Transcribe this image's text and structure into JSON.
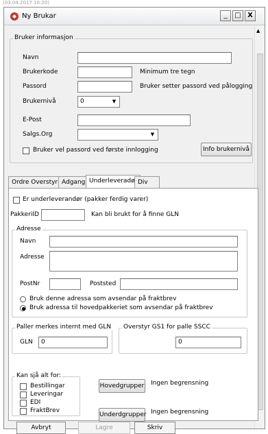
{
  "background_strip": "(03.04.2017 10:20)",
  "window": {
    "title": "Ny Brukar",
    "minimize": "_",
    "maximize": "□",
    "close": "X"
  },
  "user_info": {
    "legend": "Bruker informasjon",
    "navn_label": "Navn",
    "navn_value": "",
    "brukerkode_label": "Brukerkode",
    "brukerkode_value": "",
    "brukerkode_hint": "Minimum tre tegn",
    "passord_label": "Passord",
    "passord_value": "",
    "passord_hint": "Bruker setter passord ved pålogging",
    "brukerniva_label": "Brukernivå",
    "brukerniva_value": "0",
    "epost_label": "E-Post",
    "epost_value": "",
    "salgsorg_label": "Salgs.Org",
    "salgsorg_value": "",
    "velg_passord_label": "Bruker vel passord ved første innlogging",
    "info_button": "Info brukernivå"
  },
  "tabs": [
    "Ordre Overstyring",
    "Adgang",
    "Underleveradør",
    "Div"
  ],
  "active_tab": 2,
  "panel": {
    "underleverandor_label": "Er underleverandør (pakker ferdig varer)",
    "pakkerid_label": "PakkeriID",
    "pakkerid_value": "",
    "pakkerid_hint": "Kan bli brukt for å finne GLN",
    "adresse": {
      "legend": "Adresse",
      "navn_label": "Navn",
      "navn_value": "",
      "adresse_label": "Adresse",
      "adresse_value": "",
      "postnr_label": "PostNr",
      "postnr_value": "",
      "poststed_label": "Poststed",
      "poststed_value": "",
      "radio1": "Bruk denne adressa som avsendar på fraktbrev",
      "radio2": "Bruk adressa til hovedpakkeriet som avsendar på fraktbrev",
      "selected_radio": 2
    },
    "paller": {
      "legend": "Paller merkes internt med GLN",
      "gln_label": "GLN",
      "gln_value": "0"
    },
    "gs1": {
      "legend": "Overstyr GS1 for palle SSCC",
      "value": "0"
    },
    "kan_sja": {
      "legend": "Kan sjå alt for:",
      "items": [
        "Bestillingar",
        "Leveringar",
        "EDI",
        "FraktBrev"
      ]
    },
    "hovedgrupper_button": "Hovedgrupper",
    "hovedgrupper_status": "Ingen begrensning",
    "undergrupper_button": "Underdgrupper",
    "undergrupper_status": "Ingen begrensning"
  },
  "footer": {
    "avbryt": "Avbryt",
    "lagre": "Lagre",
    "skriv": "Skriv"
  }
}
